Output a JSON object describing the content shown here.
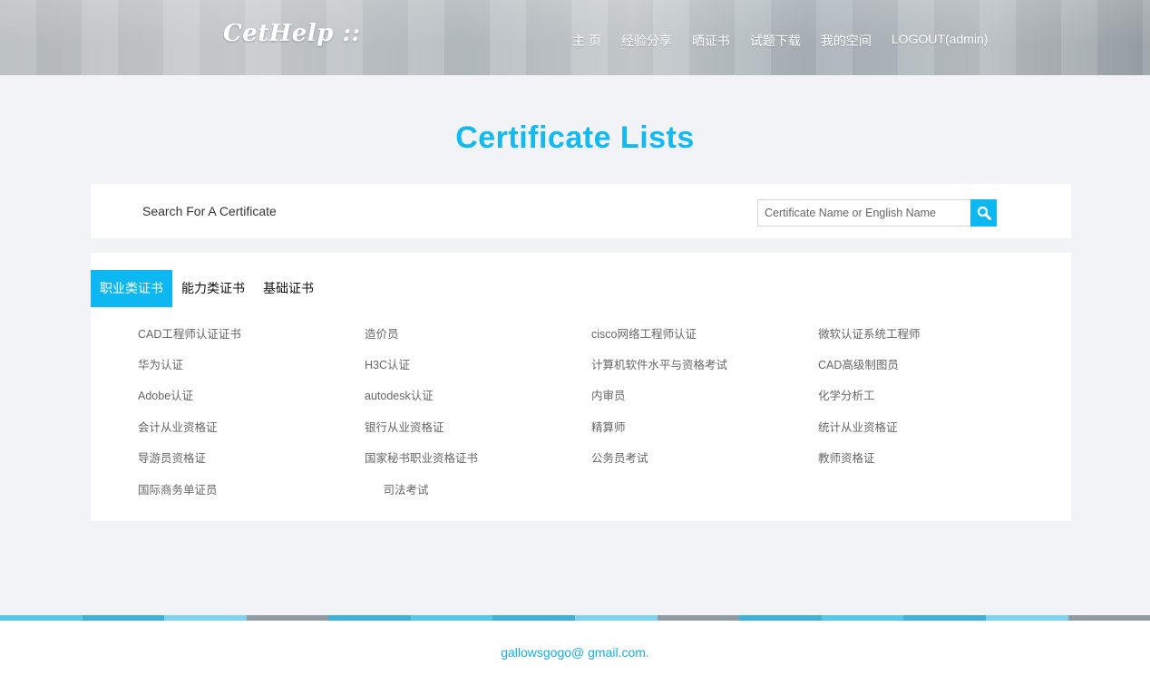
{
  "header": {
    "logo": "CetHelp ::",
    "nav": [
      "主 页",
      "经验分享",
      "晒证书",
      "试题下载",
      "我的空间",
      "LOGOUT(admin)"
    ]
  },
  "page_title": "Certificate Lists",
  "search": {
    "label": "Search For A Certificate",
    "placeholder": "Certificate Name or English Name",
    "button_icon": "search-icon"
  },
  "tabs": [
    "职业类证书",
    "能力类证书",
    "基础证书"
  ],
  "certificates": [
    [
      "CAD工程师认证证书",
      "造价员",
      "cisco网络工程师认证",
      "微软认证系统工程师"
    ],
    [
      "华为认证",
      "H3C认证",
      "计算机软件水平与资格考试",
      "CAD高级制图员"
    ],
    [
      "Adobe认证",
      "autodesk认证",
      "内审员",
      "化学分析工"
    ],
    [
      "会计从业资格证",
      "银行从业资格证",
      "精算师",
      "统计从业资格证"
    ],
    [
      "导游员资格证",
      "国家秘书职业资格证书",
      "公务员考试",
      "教师资格证"
    ],
    [
      "国际商务单证员",
      "司法考试"
    ]
  ],
  "footer": {
    "email": "gallowsgogo@ gmail.com.",
    "stripe_colors": [
      "#56c8ec",
      "#3fb0d8",
      "#7fd3f2",
      "#8f9aa3",
      "#3fb0d8",
      "#56c8ec",
      "#3fb0d8",
      "#7fd3f2",
      "#8f9aa3",
      "#3fb0d8",
      "#56c8ec",
      "#3fb0d8",
      "#7fd3f2",
      "#8f9aa3"
    ]
  },
  "colors": {
    "accent": "#0db7f2",
    "title": "#14b9f0",
    "background": "#f2f3f7"
  }
}
